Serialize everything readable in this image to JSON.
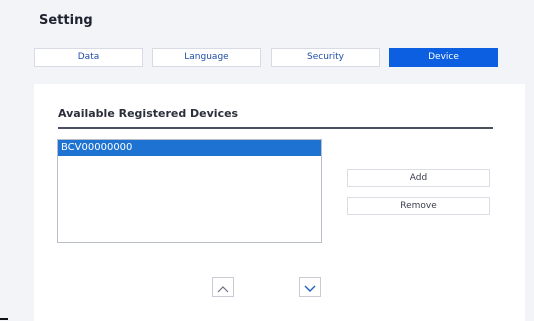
{
  "header": {
    "title": "Setting"
  },
  "tabs": [
    {
      "label": "Data",
      "active": false
    },
    {
      "label": "Language",
      "active": false
    },
    {
      "label": "Security",
      "active": false
    },
    {
      "label": "Device",
      "active": true
    }
  ],
  "section": {
    "title": "Available Registered Devices"
  },
  "devices": [
    {
      "name": "BCV00000000",
      "selected": true
    }
  ],
  "actions": {
    "add_label": "Add",
    "remove_label": "Remove"
  },
  "icons": {
    "up": "chevron-up-icon",
    "down": "chevron-down-icon"
  },
  "colors": {
    "accent": "#0b5fe0",
    "selection": "#1e73d2",
    "tab_text": "#1f4ea8"
  }
}
